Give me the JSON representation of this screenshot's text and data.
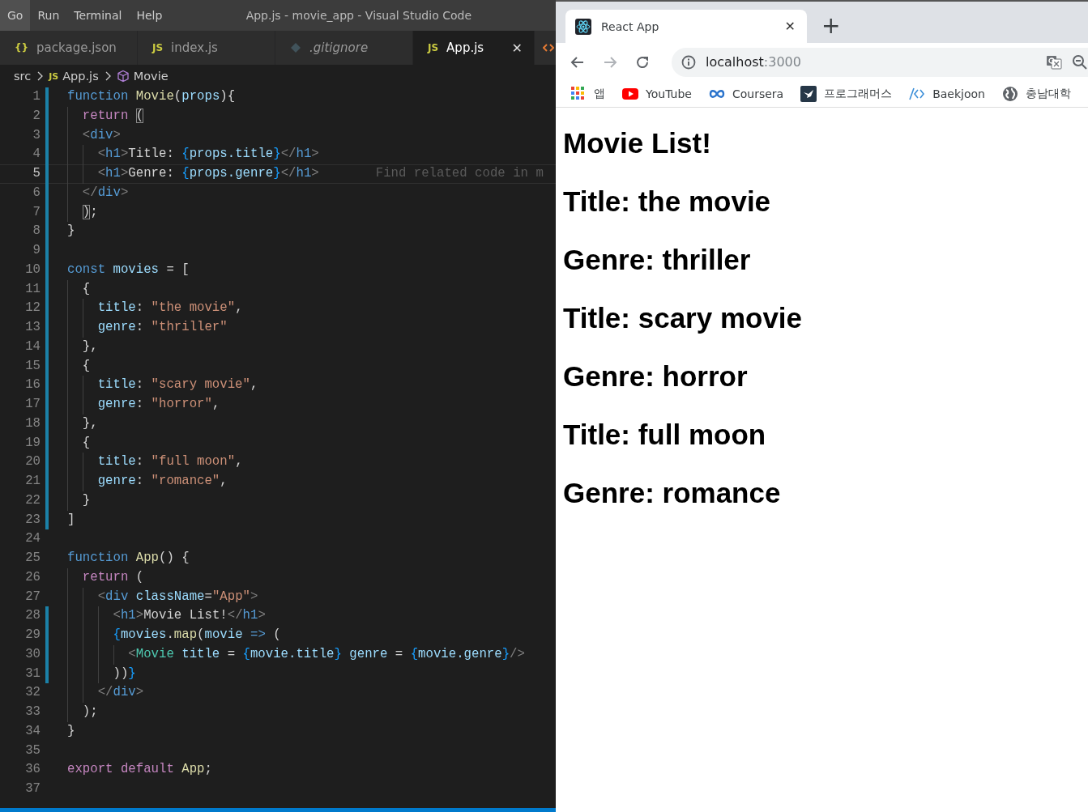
{
  "editor_window": {
    "menu": [
      {
        "label": "Go",
        "selected": true
      },
      {
        "label": "Run",
        "selected": false
      },
      {
        "label": "Terminal",
        "selected": false
      },
      {
        "label": "Help",
        "selected": false
      }
    ],
    "title": "App.js - movie_app - Visual Studio Code",
    "tabs": [
      {
        "kind": "json",
        "icon": "{}",
        "label": "package.json",
        "selected": false,
        "italic": false
      },
      {
        "kind": "js",
        "icon": "JS",
        "label": "index.js",
        "selected": false,
        "italic": false
      },
      {
        "kind": "git",
        "label": ".gitignore",
        "selected": false,
        "italic": true
      },
      {
        "kind": "js",
        "icon": "JS",
        "label": "App.js",
        "selected": true,
        "italic": false,
        "close": "✕"
      },
      {
        "kind": "html",
        "selected": false
      }
    ],
    "breadcrumb": [
      {
        "kind": "folder",
        "label": "src"
      },
      {
        "kind": "js",
        "icon": "JS",
        "label": "App.js"
      },
      {
        "kind": "symbol",
        "label": "Movie"
      }
    ],
    "lines": [
      {
        "n": "1",
        "modified": true,
        "current": false,
        "tokens": [
          {
            "kind": "keyword",
            "text": "function "
          },
          {
            "kind": "function",
            "text": "Movie"
          },
          {
            "kind": "plain",
            "text": "("
          },
          {
            "kind": "variable",
            "text": "props"
          },
          {
            "kind": "plain",
            "text": "){"
          }
        ]
      },
      {
        "n": "2",
        "modified": true,
        "current": false,
        "tokens": [
          {
            "kind": "control",
            "text": "  return "
          },
          {
            "kind": "match",
            "text": "("
          }
        ]
      },
      {
        "n": "3",
        "modified": true,
        "current": false,
        "tokens": [
          {
            "kind": "angle",
            "text": "  <"
          },
          {
            "kind": "tag",
            "text": "div"
          },
          {
            "kind": "angle",
            "text": ">"
          }
        ]
      },
      {
        "n": "4",
        "modified": true,
        "current": false,
        "tokens": [
          {
            "kind": "angle",
            "text": "    <"
          },
          {
            "kind": "tag",
            "text": "h1"
          },
          {
            "kind": "angle",
            "text": ">"
          },
          {
            "kind": "plain",
            "text": "Title: "
          },
          {
            "kind": "brace",
            "text": "{"
          },
          {
            "kind": "variable",
            "text": "props.title"
          },
          {
            "kind": "brace",
            "text": "}"
          },
          {
            "kind": "angle",
            "text": "</"
          },
          {
            "kind": "tag",
            "text": "h1"
          },
          {
            "kind": "angle",
            "text": ">"
          }
        ]
      },
      {
        "n": "5",
        "modified": true,
        "current": true,
        "tokens": [
          {
            "kind": "angle",
            "text": "    <"
          },
          {
            "kind": "tag",
            "text": "h1"
          },
          {
            "kind": "angle",
            "text": ">"
          },
          {
            "kind": "plain",
            "text": "Genre: "
          },
          {
            "kind": "brace",
            "text": "{"
          },
          {
            "kind": "variable",
            "text": "props.genre"
          },
          {
            "kind": "brace",
            "text": "}"
          },
          {
            "kind": "angle",
            "text": "</"
          },
          {
            "kind": "tag",
            "text": "h1"
          },
          {
            "kind": "angle",
            "text": ">"
          }
        ],
        "hint": "Find related code in m"
      },
      {
        "n": "6",
        "modified": true,
        "current": false,
        "tokens": [
          {
            "kind": "angle",
            "text": "  </"
          },
          {
            "kind": "tag",
            "text": "div"
          },
          {
            "kind": "angle",
            "text": ">"
          }
        ]
      },
      {
        "n": "7",
        "modified": true,
        "current": false,
        "tokens": [
          {
            "kind": "match",
            "text": "  )"
          },
          {
            "kind": "plain",
            "text": ";"
          }
        ]
      },
      {
        "n": "8",
        "modified": true,
        "current": false,
        "tokens": [
          {
            "kind": "plain",
            "text": "}"
          }
        ]
      },
      {
        "n": "9",
        "modified": true,
        "current": false
      },
      {
        "n": "10",
        "modified": true,
        "current": false,
        "tokens": [
          {
            "kind": "keyword",
            "text": "const "
          },
          {
            "kind": "variable",
            "text": "movies"
          },
          {
            "kind": "plain",
            "text": " = ["
          }
        ]
      },
      {
        "n": "11",
        "modified": true,
        "current": false,
        "tokens": [
          {
            "kind": "plain",
            "text": "  {"
          }
        ]
      },
      {
        "n": "12",
        "modified": true,
        "current": false,
        "tokens": [
          {
            "kind": "variable",
            "text": "    title"
          },
          {
            "kind": "plain",
            "text": ": "
          },
          {
            "kind": "string",
            "text": "\"the movie\""
          },
          {
            "kind": "plain",
            "text": ","
          }
        ]
      },
      {
        "n": "13",
        "modified": true,
        "current": false,
        "tokens": [
          {
            "kind": "variable",
            "text": "    genre"
          },
          {
            "kind": "plain",
            "text": ": "
          },
          {
            "kind": "string",
            "text": "\"thriller\""
          }
        ]
      },
      {
        "n": "14",
        "modified": true,
        "current": false,
        "tokens": [
          {
            "kind": "plain",
            "text": "  },"
          }
        ]
      },
      {
        "n": "15",
        "modified": true,
        "current": false,
        "tokens": [
          {
            "kind": "plain",
            "text": "  {"
          }
        ]
      },
      {
        "n": "16",
        "modified": true,
        "current": false,
        "tokens": [
          {
            "kind": "variable",
            "text": "    title"
          },
          {
            "kind": "plain",
            "text": ": "
          },
          {
            "kind": "string",
            "text": "\"scary movie\""
          },
          {
            "kind": "plain",
            "text": ","
          }
        ]
      },
      {
        "n": "17",
        "modified": true,
        "current": false,
        "tokens": [
          {
            "kind": "variable",
            "text": "    genre"
          },
          {
            "kind": "plain",
            "text": ": "
          },
          {
            "kind": "string",
            "text": "\"horror\""
          },
          {
            "kind": "plain",
            "text": ","
          }
        ]
      },
      {
        "n": "18",
        "modified": true,
        "current": false,
        "tokens": [
          {
            "kind": "plain",
            "text": "  },"
          }
        ]
      },
      {
        "n": "19",
        "modified": true,
        "current": false,
        "tokens": [
          {
            "kind": "plain",
            "text": "  {"
          }
        ]
      },
      {
        "n": "20",
        "modified": true,
        "current": false,
        "tokens": [
          {
            "kind": "variable",
            "text": "    title"
          },
          {
            "kind": "plain",
            "text": ": "
          },
          {
            "kind": "string",
            "text": "\"full moon\""
          },
          {
            "kind": "plain",
            "text": ","
          }
        ]
      },
      {
        "n": "21",
        "modified": true,
        "current": false,
        "tokens": [
          {
            "kind": "variable",
            "text": "    genre"
          },
          {
            "kind": "plain",
            "text": ": "
          },
          {
            "kind": "string",
            "text": "\"romance\""
          },
          {
            "kind": "plain",
            "text": ","
          }
        ]
      },
      {
        "n": "22",
        "modified": true,
        "current": false,
        "tokens": [
          {
            "kind": "plain",
            "text": "  }"
          }
        ]
      },
      {
        "n": "23",
        "modified": true,
        "current": false,
        "tokens": [
          {
            "kind": "plain",
            "text": "]"
          }
        ]
      },
      {
        "n": "24",
        "modified": false,
        "current": false
      },
      {
        "n": "25",
        "modified": false,
        "current": false,
        "tokens": [
          {
            "kind": "keyword",
            "text": "function "
          },
          {
            "kind": "function",
            "text": "App"
          },
          {
            "kind": "plain",
            "text": "() {"
          }
        ]
      },
      {
        "n": "26",
        "modified": false,
        "current": false,
        "tokens": [
          {
            "kind": "control",
            "text": "  return "
          },
          {
            "kind": "plain",
            "text": "("
          }
        ]
      },
      {
        "n": "27",
        "modified": false,
        "current": false,
        "tokens": [
          {
            "kind": "angle",
            "text": "    <"
          },
          {
            "kind": "tag",
            "text": "div "
          },
          {
            "kind": "variable",
            "text": "className"
          },
          {
            "kind": "plain",
            "text": "="
          },
          {
            "kind": "string",
            "text": "\"App\""
          },
          {
            "kind": "angle",
            "text": ">"
          }
        ]
      },
      {
        "n": "28",
        "modified": true,
        "current": false,
        "tokens": [
          {
            "kind": "angle",
            "text": "      <"
          },
          {
            "kind": "tag",
            "text": "h1"
          },
          {
            "kind": "angle",
            "text": ">"
          },
          {
            "kind": "plain",
            "text": "Movie List!"
          },
          {
            "kind": "angle",
            "text": "</"
          },
          {
            "kind": "tag",
            "text": "h1"
          },
          {
            "kind": "angle",
            "text": ">"
          }
        ]
      },
      {
        "n": "29",
        "modified": true,
        "current": false,
        "tokens": [
          {
            "kind": "brace",
            "text": "      {"
          },
          {
            "kind": "variable",
            "text": "movies"
          },
          {
            "kind": "plain",
            "text": "."
          },
          {
            "kind": "function",
            "text": "map"
          },
          {
            "kind": "plain",
            "text": "("
          },
          {
            "kind": "variable",
            "text": "movie "
          },
          {
            "kind": "keyword",
            "text": "=>"
          },
          {
            "kind": "plain",
            "text": " ("
          }
        ]
      },
      {
        "n": "30",
        "modified": true,
        "current": false,
        "tokens": [
          {
            "kind": "angle",
            "text": "        <"
          },
          {
            "kind": "component",
            "text": "Movie "
          },
          {
            "kind": "variable",
            "text": "title "
          },
          {
            "kind": "plain",
            "text": "= "
          },
          {
            "kind": "brace",
            "text": "{"
          },
          {
            "kind": "variable",
            "text": "movie.title"
          },
          {
            "kind": "brace",
            "text": "}"
          },
          {
            "kind": "variable",
            "text": " genre "
          },
          {
            "kind": "plain",
            "text": "= "
          },
          {
            "kind": "brace",
            "text": "{"
          },
          {
            "kind": "variable",
            "text": "movie.genre"
          },
          {
            "kind": "brace",
            "text": "}"
          },
          {
            "kind": "angle",
            "text": "/>"
          }
        ]
      },
      {
        "n": "31",
        "modified": true,
        "current": false,
        "tokens": [
          {
            "kind": "plain",
            "text": "      ))"
          },
          {
            "kind": "brace",
            "text": "}"
          }
        ]
      },
      {
        "n": "32",
        "modified": false,
        "current": false,
        "tokens": [
          {
            "kind": "angle",
            "text": "    </"
          },
          {
            "kind": "tag",
            "text": "div"
          },
          {
            "kind": "angle",
            "text": ">"
          }
        ]
      },
      {
        "n": "33",
        "modified": false,
        "current": false,
        "tokens": [
          {
            "kind": "plain",
            "text": "  );"
          }
        ]
      },
      {
        "n": "34",
        "modified": false,
        "current": false,
        "tokens": [
          {
            "kind": "plain",
            "text": "}"
          }
        ]
      },
      {
        "n": "35",
        "modified": false,
        "current": false
      },
      {
        "n": "36",
        "modified": false,
        "current": false,
        "tokens": [
          {
            "kind": "control",
            "text": "export default "
          },
          {
            "kind": "function",
            "text": "App"
          },
          {
            "kind": "plain",
            "text": ";"
          }
        ]
      },
      {
        "n": "37",
        "modified": false,
        "current": false
      }
    ]
  },
  "browser": {
    "tab": {
      "title": "React App",
      "close": "✕"
    },
    "new_tab": "+",
    "nav": [
      {
        "kind": "back",
        "disabled": false
      },
      {
        "kind": "forward",
        "disabled": true
      },
      {
        "kind": "reload",
        "disabled": false
      }
    ],
    "address": {
      "host": "localhost",
      "port": ":3000"
    },
    "bookmarks": [
      {
        "kind": "apps",
        "label": "앱"
      },
      {
        "kind": "youtube",
        "label": "YouTube"
      },
      {
        "kind": "coursera",
        "label": "Coursera"
      },
      {
        "kind": "programmers",
        "label": "프로그래머스"
      },
      {
        "kind": "code",
        "label": "Baekjoon"
      },
      {
        "kind": "globe",
        "label": "충남대학"
      }
    ],
    "page": {
      "headings": [
        "Movie List!",
        "Title: the movie",
        "Genre: thriller",
        "Title: scary movie",
        "Genre: horror",
        "Title: full moon",
        "Genre: romance"
      ]
    }
  }
}
